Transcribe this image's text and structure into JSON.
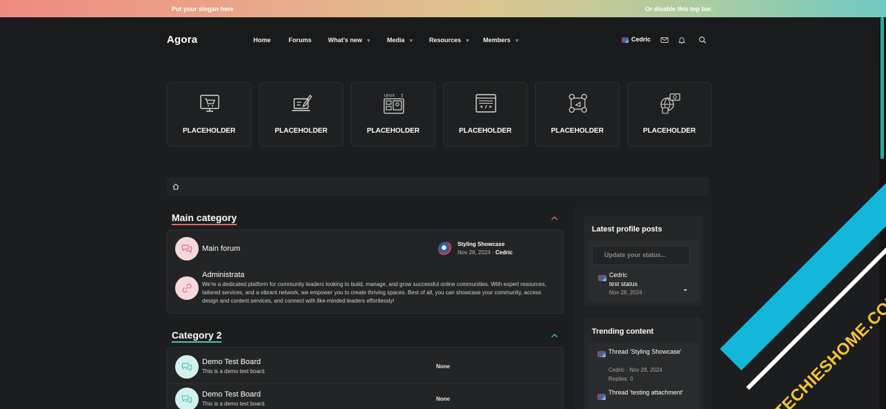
{
  "topbar": {
    "slogan": "Put your slogan here",
    "disable": "Or disable this top bar."
  },
  "header": {
    "logo": "Agora",
    "nav": [
      {
        "label": "Home"
      },
      {
        "label": "Forums"
      },
      {
        "label": "What's new"
      },
      {
        "label": "Media"
      },
      {
        "label": "Resources"
      },
      {
        "label": "Members"
      }
    ],
    "user": "Cedric",
    "icons": [
      "envelope-icon",
      "bell-icon",
      "search-icon"
    ]
  },
  "tiles": [
    {
      "label": "PLACEHOLDER",
      "icon": "shopping-cart-monitor-icon"
    },
    {
      "label": "PLACEHOLDER",
      "icon": "laptop-pen-icon"
    },
    {
      "label": "PLACEHOLDER",
      "icon": "ui-ux-layout-icon"
    },
    {
      "label": "PLACEHOLDER",
      "icon": "code-window-icon"
    },
    {
      "label": "PLACEHOLDER",
      "icon": "social-media-icon"
    },
    {
      "label": "PLACEHOLDER",
      "icon": "web-devices-icon"
    }
  ],
  "main": {
    "categories": [
      {
        "title": "Main category",
        "accent": "#e56a6a",
        "nodes": [
          {
            "title": "Main forum",
            "latest_title": "Styling Showcase",
            "latest_date": "Nov 28, 2024 ·",
            "latest_user": "Cedric"
          },
          {
            "title": "Administrata",
            "description": "We're a dedicated platform for community leaders looking to build, manage, and grow successful online communities. With expert resources, tailored services, and a vibrant network, we empower you to create thriving spaces. Best of all, you can showcase your community, access design and content services, and connect with like-minded leaders effortlessly!"
          }
        ]
      },
      {
        "title": "Category 2",
        "accent": "#45c7b8",
        "nodes": [
          {
            "title": "Demo Test Board",
            "description": "This is a demo test board.",
            "latest": "None"
          },
          {
            "title": "Demo Test Board",
            "description": "This is a demo test board.",
            "latest": "None"
          }
        ]
      }
    ]
  },
  "sidebar": {
    "profile_posts": {
      "title": "Latest profile posts",
      "placeholder": "Update your status...",
      "post": {
        "user": "Cedric",
        "text": "test status",
        "date": "Nov 28, 2024",
        "more": "•••"
      }
    },
    "trending": {
      "title": "Trending content",
      "items": [
        {
          "title": "Thread 'Styling Showcase'",
          "meta": "Cedric · Nov 28, 2024",
          "replies": "Replies: 0"
        },
        {
          "title": "Thread 'testing attachment'"
        }
      ]
    }
  },
  "watermark": "TECHIESHOME.COM",
  "colors": {
    "accent_red": "#e56a6a",
    "accent_teal": "#45c7b8",
    "watermark_ribbon": "#13b7d9",
    "watermark_text": "#f4c430"
  }
}
